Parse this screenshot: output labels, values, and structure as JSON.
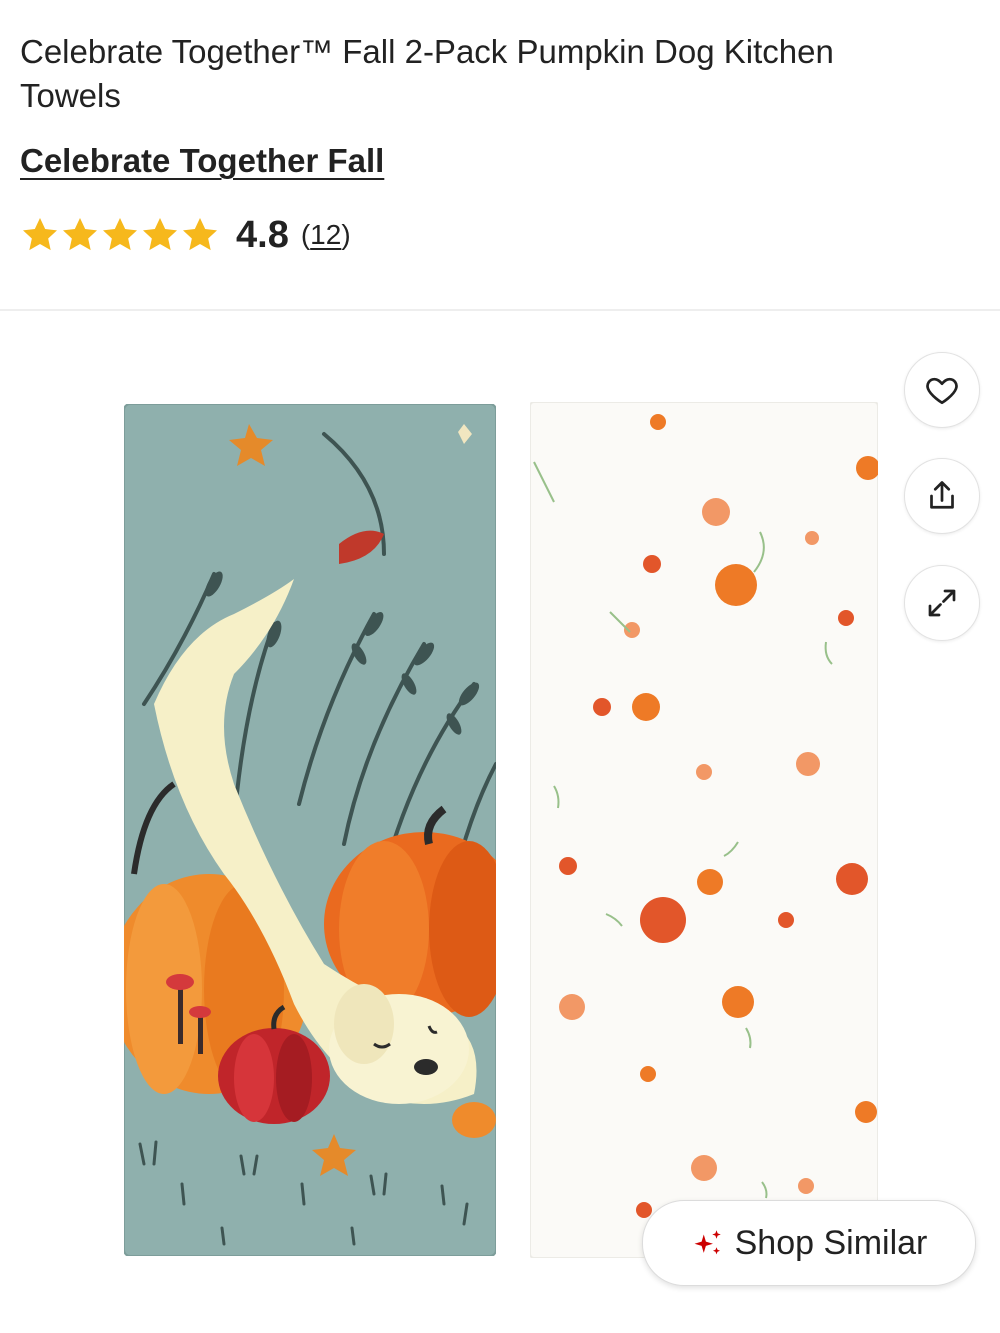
{
  "product": {
    "title": "Celebrate Together™ Fall 2-Pack Pumpkin Dog Kitchen Towels",
    "brand": "Celebrate Together Fall"
  },
  "rating": {
    "value": "4.8",
    "count_open": "(",
    "count": "12",
    "count_close": ")",
    "stars_filled": 5,
    "star_color": "#f6b81c"
  },
  "gallery": {
    "actions": [
      {
        "name": "favorite",
        "icon": "heart-icon"
      },
      {
        "name": "share",
        "icon": "share-icon"
      },
      {
        "name": "expand",
        "icon": "expand-icon"
      }
    ],
    "shop_similar_label": "Shop Similar",
    "shop_similar_icon": "sparkle-icon",
    "sparkle_color": "#cc0000"
  },
  "colors": {
    "towel_left_bg": "#8fb0ad",
    "towel_right_bg": "#fbfaf7",
    "pumpkin": "#ee7a26"
  }
}
